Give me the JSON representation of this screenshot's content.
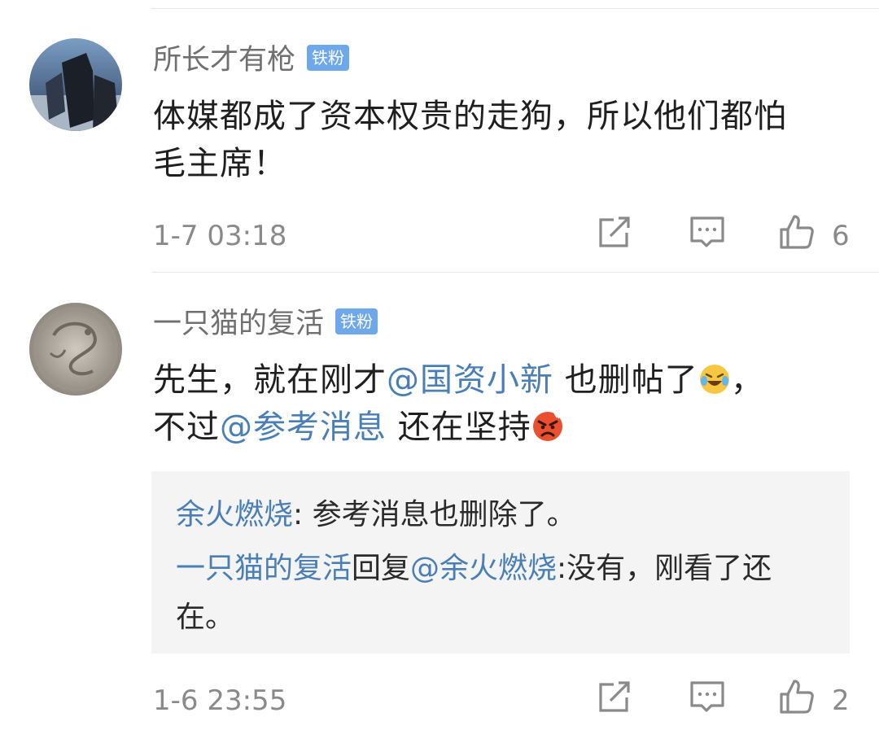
{
  "comments": [
    {
      "username": "所长才有枪",
      "badge": "铁粉",
      "text_line1": "体媒都成了资本权贵的走狗，所以他们都怕",
      "text_line2": "毛主席！",
      "time": "1-7 03:18",
      "likes": "6"
    },
    {
      "username": "一只猫的复活",
      "badge": "铁粉",
      "text_part1": "先生，就在刚才",
      "mention1": "@国资小新",
      "text_part2": " 也删帖了",
      "text_part3": "，",
      "text_part4": "不过",
      "mention2": "@参考消息",
      "text_part5": " 还在坚持",
      "time": "1-6 23:55",
      "likes": "2",
      "replies": [
        {
          "name": "余火燃烧",
          "sep": ": ",
          "text": "参考消息也删除了。"
        },
        {
          "name": "一只猫的复活",
          "mid": "回复",
          "mention": "@余火燃烧",
          "text_line1": ":没有，刚看了还",
          "text_line2": "在。"
        }
      ]
    }
  ],
  "icons": {
    "share": "share-icon",
    "comment": "comment-icon",
    "like": "thumbs-up-icon",
    "emoji1": "laughing-crying-emoji-icon",
    "emoji2": "angry-face-emoji-icon"
  },
  "colors": {
    "mention": "#4a7fb5",
    "badge": "#6fa8ea",
    "reply_bg": "#f4f4f4"
  }
}
